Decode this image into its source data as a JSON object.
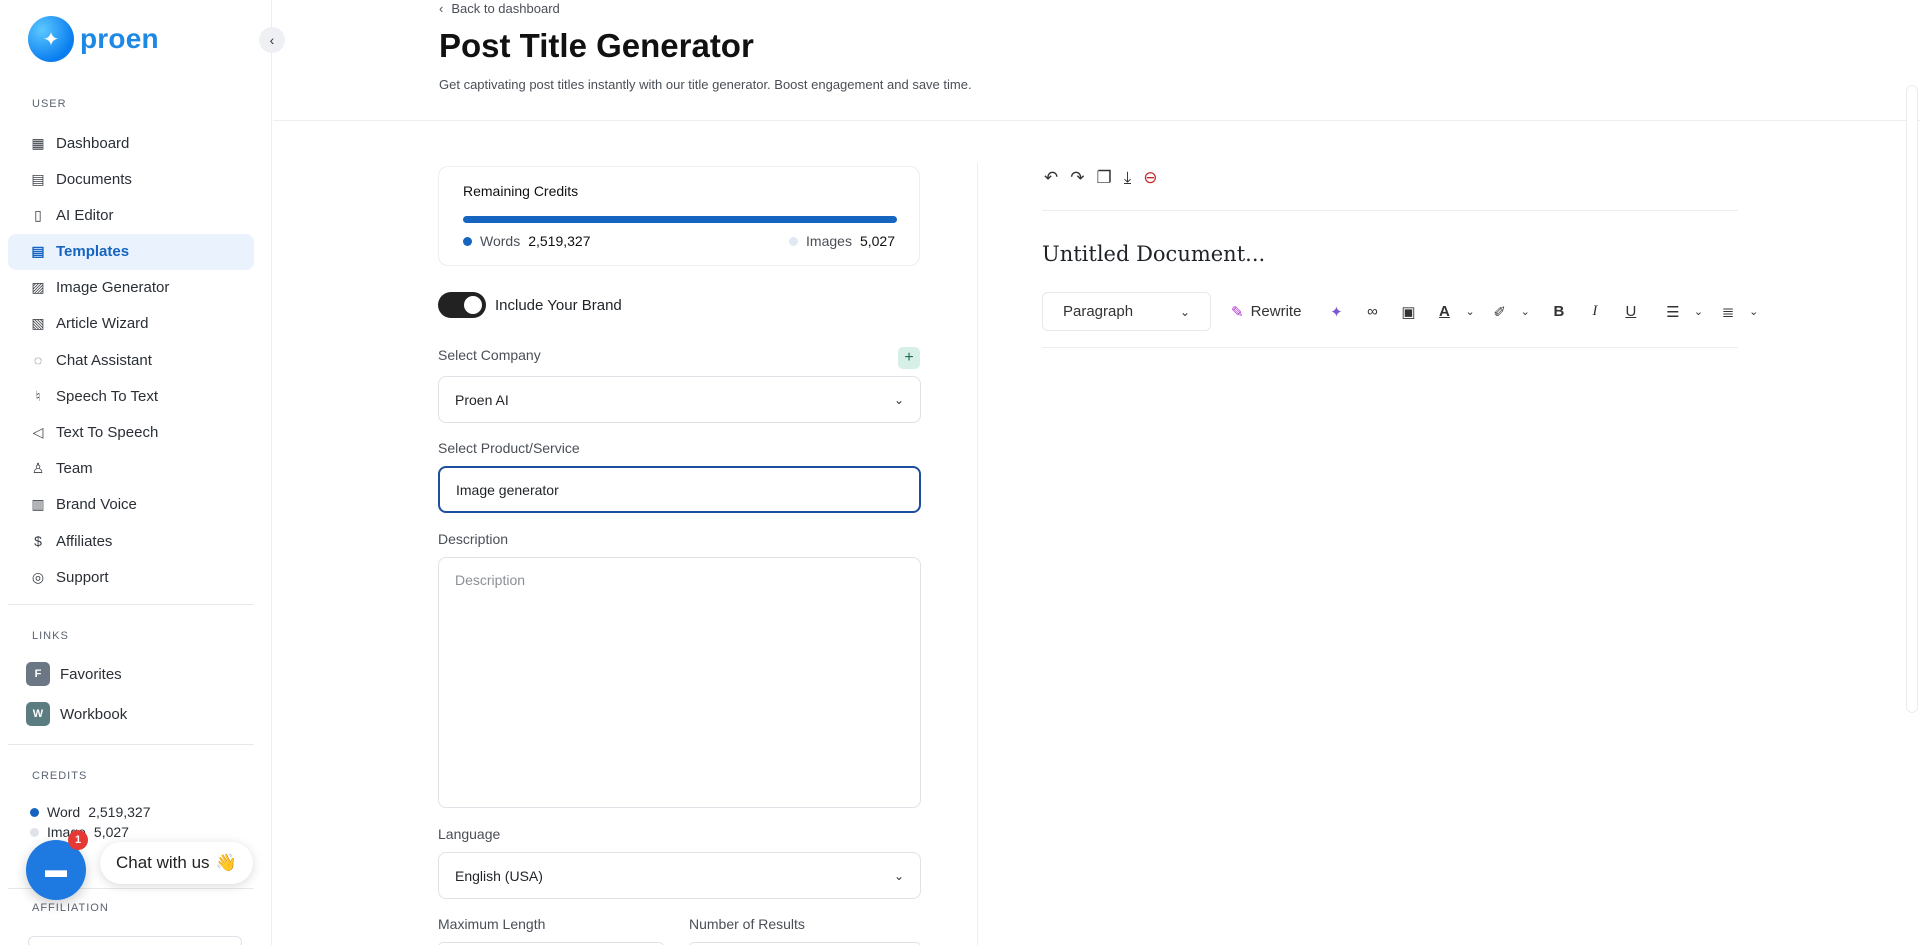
{
  "brand": {
    "name": "proen"
  },
  "sidebar": {
    "user_label": "USER",
    "items": [
      {
        "label": "Dashboard",
        "icon": "grid-icon"
      },
      {
        "label": "Documents",
        "icon": "archive-icon"
      },
      {
        "label": "AI Editor",
        "icon": "notebook-icon"
      },
      {
        "label": "Templates",
        "icon": "file-text-icon",
        "active": true
      },
      {
        "label": "Image Generator",
        "icon": "image-icon"
      },
      {
        "label": "Article Wizard",
        "icon": "article-icon"
      },
      {
        "label": "Chat Assistant",
        "icon": "chat-icon"
      },
      {
        "label": "Speech To Text",
        "icon": "mic-icon"
      },
      {
        "label": "Text To Speech",
        "icon": "speaker-icon"
      },
      {
        "label": "Team",
        "icon": "user-plus-icon"
      },
      {
        "label": "Brand Voice",
        "icon": "brand-icon"
      },
      {
        "label": "Affiliates",
        "icon": "dollar-icon"
      },
      {
        "label": "Support",
        "icon": "lifebuoy-icon"
      }
    ],
    "links_label": "LINKS",
    "links": [
      {
        "badge": "F",
        "label": "Favorites",
        "color": "#6b7785"
      },
      {
        "badge": "W",
        "label": "Workbook",
        "color": "#5b7c80"
      }
    ],
    "credits_label": "CREDITS",
    "credits": {
      "word_label": "Word",
      "word_value": "2,519,327",
      "image_label": "Image",
      "image_value": "5,027"
    },
    "affiliation_label": "AFFILIATION"
  },
  "chat": {
    "badge": "1",
    "label": "Chat with us",
    "emoji": "👋"
  },
  "header": {
    "back_label": "Back to dashboard",
    "title": "Post Title Generator",
    "subtitle": "Get captivating post titles instantly with our title generator. Boost engagement and save time."
  },
  "form": {
    "credits_title": "Remaining Credits",
    "words_label": "Words",
    "words_value": "2,519,327",
    "images_label": "Images",
    "images_value": "5,027",
    "include_brand_label": "Include Your Brand",
    "include_brand_on": true,
    "company_label": "Select Company",
    "company_value": "Proen AI",
    "product_label": "Select Product/Service",
    "product_value": "Image generator",
    "description_label": "Description",
    "description_placeholder": "Description",
    "language_label": "Language",
    "language_value": "English (USA)",
    "max_length_label": "Maximum Length",
    "results_label": "Number of Results"
  },
  "editor": {
    "doc_title": "Untitled Document...",
    "paragraph_label": "Paragraph",
    "rewrite_label": "Rewrite"
  },
  "colors": {
    "accent": "#1565c0",
    "active_bg": "#eaf3fd",
    "brand": "#1e88e5"
  }
}
